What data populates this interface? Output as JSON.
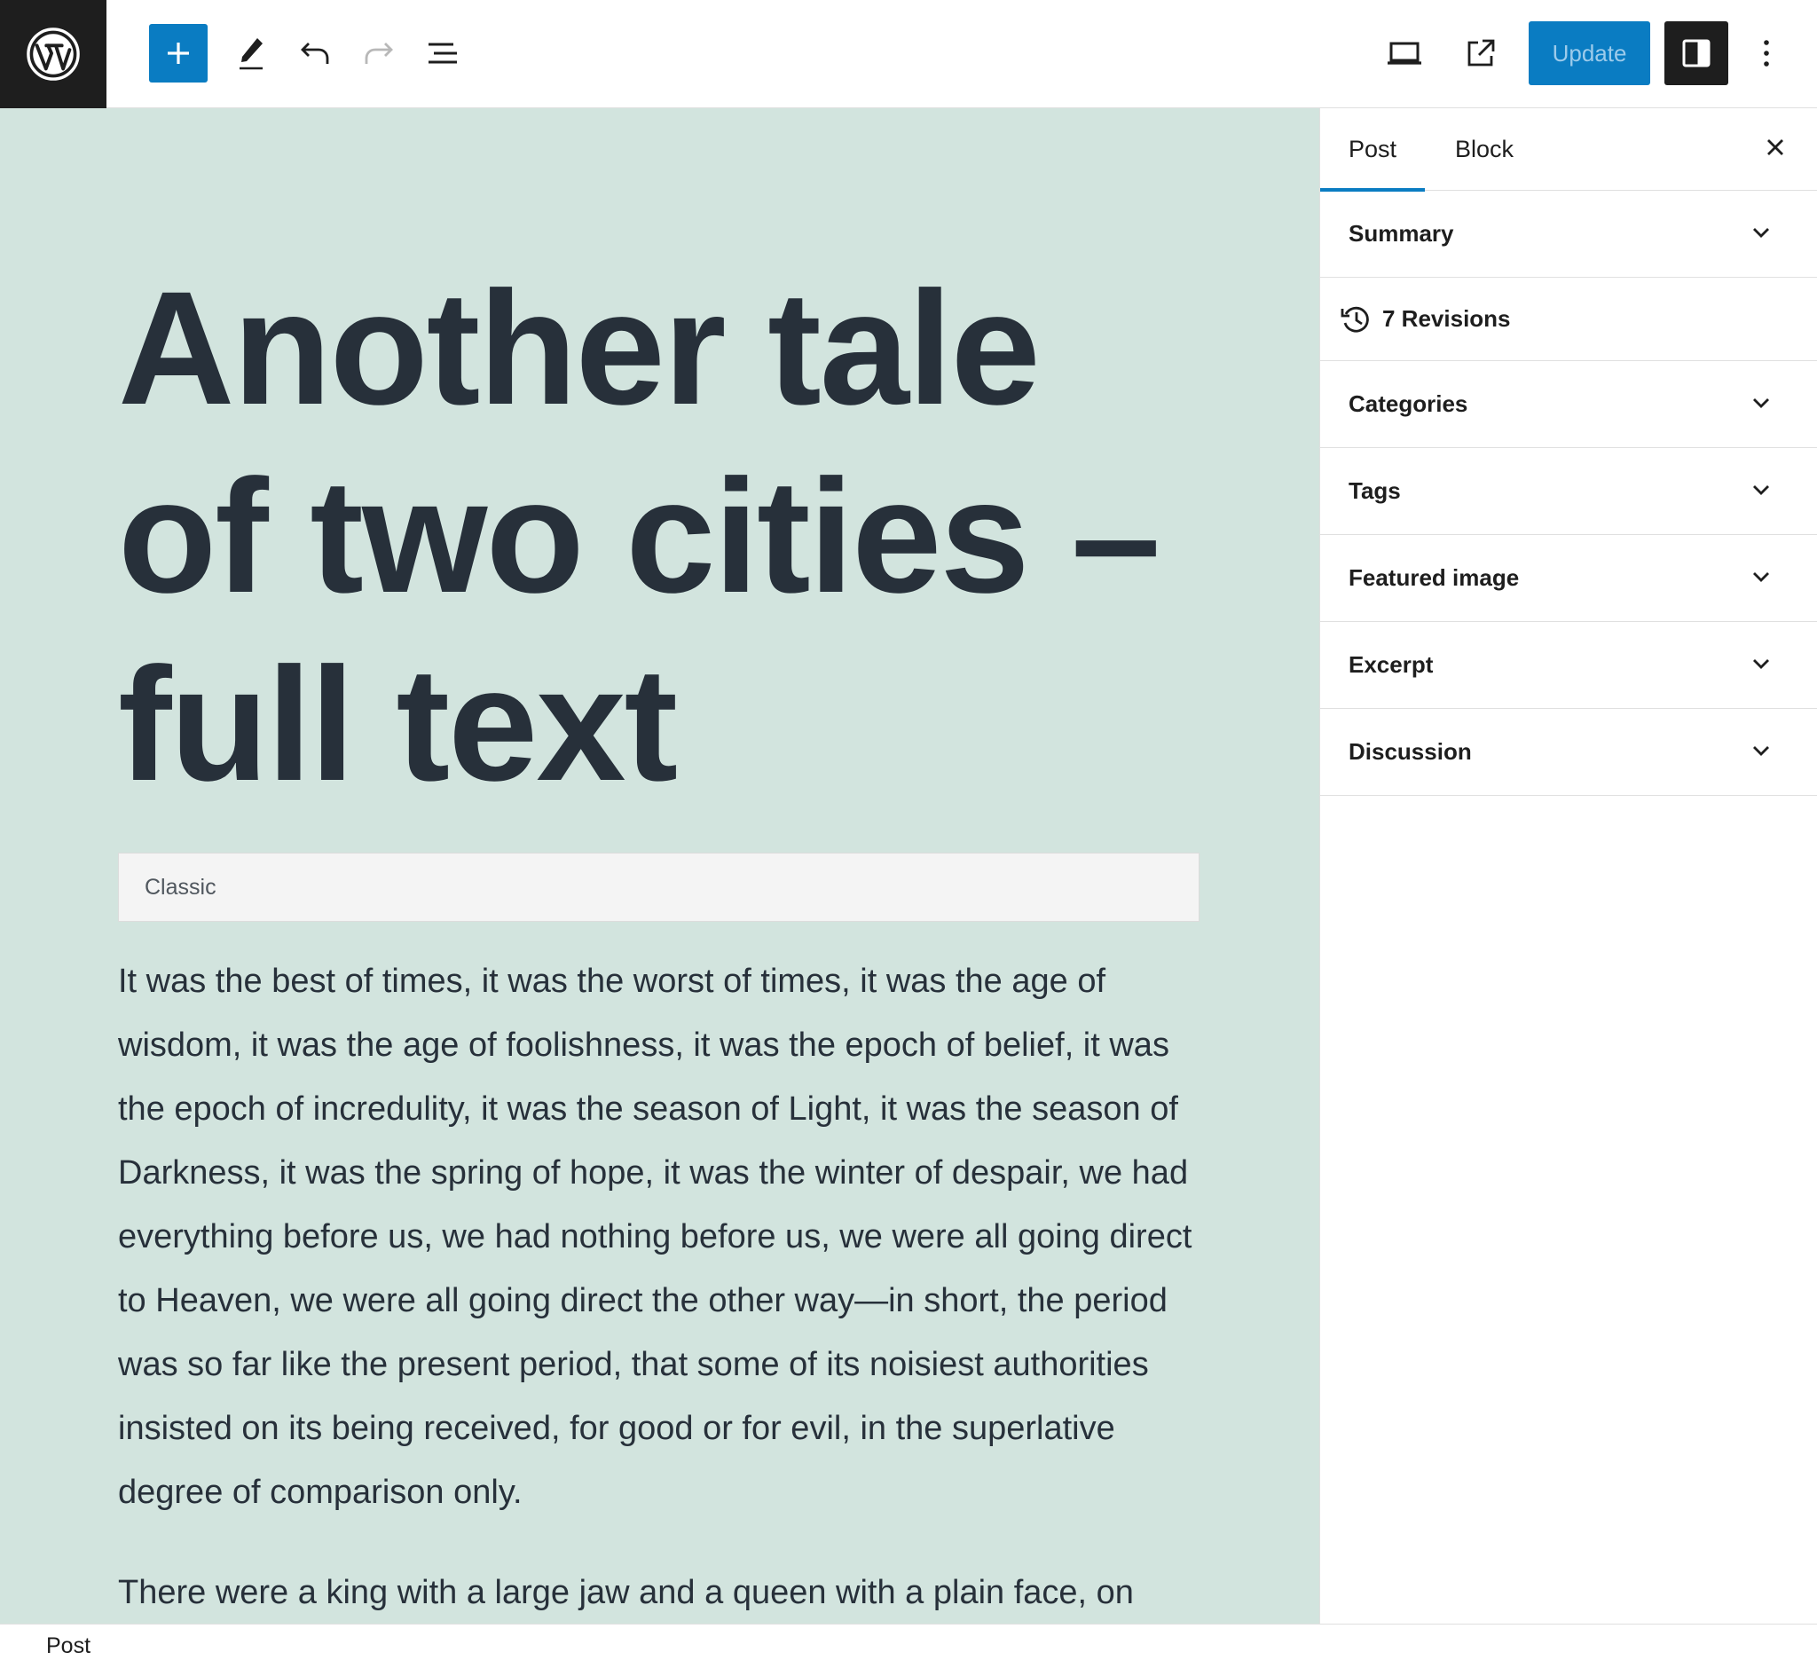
{
  "toolbar": {
    "logo_icon": "wordpress-icon",
    "add_icon": "plus-icon",
    "edit_icon": "pencil-icon",
    "undo_icon": "undo-icon",
    "redo_icon": "redo-icon",
    "list_view_icon": "list-view-icon",
    "view_icon": "desktop-icon",
    "preview_icon": "external-link-icon",
    "update_label": "Update",
    "settings_icon": "sidebar-icon",
    "options_icon": "more-vertical-icon",
    "accent_color": "#0a7cc2"
  },
  "canvas": {
    "background": "#d2e4de",
    "title": "Another tale of two cities – full text",
    "classic_block_label": "Classic",
    "paragraphs": [
      "It was the best of times, it was the worst of times, it was the age of wisdom, it was the age of foolishness, it was the epoch of belief, it was the epoch of incredulity, it was the season of Light, it was the season of Darkness, it was the spring of hope, it was the winter of despair, we had everything before us, we had nothing before us, we were all going direct to Heaven, we were all going direct the other way—in short, the period was so far like the present period, that some of its noisiest authorities insisted on its being received, for good or for evil, in the superlative degree of comparison only.",
      "There were a king with a large jaw and a queen with a plain face, on"
    ]
  },
  "sidebar": {
    "tabs": [
      {
        "label": "Post",
        "active": true
      },
      {
        "label": "Block",
        "active": false
      }
    ],
    "close_icon": "close-icon",
    "revisions_label": "7 Revisions",
    "revisions_icon": "history-icon",
    "panels": [
      {
        "label": "Summary"
      },
      {
        "label": "Categories"
      },
      {
        "label": "Tags"
      },
      {
        "label": "Featured image"
      },
      {
        "label": "Excerpt"
      },
      {
        "label": "Discussion"
      }
    ]
  },
  "footer": {
    "breadcrumb": "Post"
  }
}
